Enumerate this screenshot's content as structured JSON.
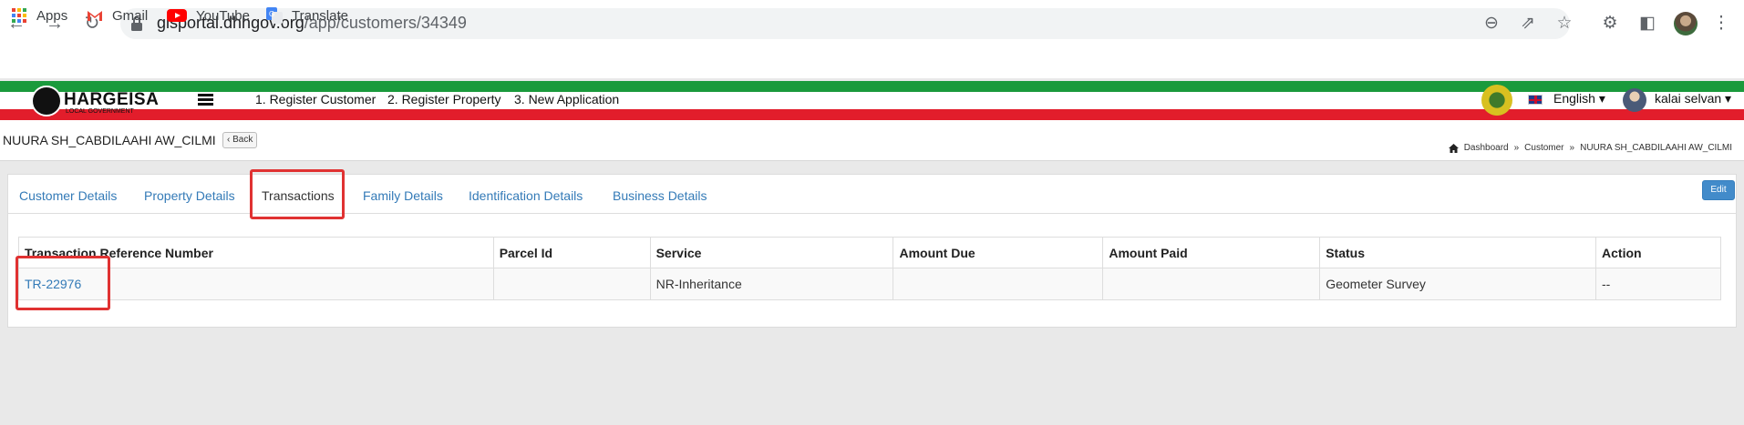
{
  "browser": {
    "url_domain": "gisportal.dhhgov.org",
    "url_path": "/app/customers/34349",
    "bookmarks": [
      {
        "label": "Apps"
      },
      {
        "label": "Gmail"
      },
      {
        "label": "YouTube"
      },
      {
        "label": "Translate"
      }
    ]
  },
  "app": {
    "logo_title": "HARGEISA",
    "logo_subtitle": "LOCAL GOVERNMENT",
    "menu": [
      {
        "label": "1. Register Customer"
      },
      {
        "label": "2. Register Property"
      },
      {
        "label": "3. New Application"
      }
    ],
    "language": "English",
    "user_name": "kalai selvan"
  },
  "page": {
    "customer_name": "NUURA SH_CABDILAAHI AW_CILMI",
    "back_label": "Back",
    "breadcrumb": [
      {
        "label": "Dashboard"
      },
      {
        "label": "Customer"
      },
      {
        "label": "NUURA SH_CABDILAAHI AW_CILMI"
      }
    ],
    "breadcrumb_sep": "»"
  },
  "tabs": [
    {
      "label": "Customer Details",
      "active": false
    },
    {
      "label": "Property Details",
      "active": false
    },
    {
      "label": "Transactions",
      "active": true
    },
    {
      "label": "Family Details",
      "active": false
    },
    {
      "label": "Identification Details",
      "active": false
    },
    {
      "label": "Business Details",
      "active": false
    }
  ],
  "edit_label": "Edit",
  "table": {
    "columns": [
      "Transaction Reference Number",
      "Parcel Id",
      "Service",
      "Amount Due",
      "Amount Paid",
      "Status",
      "Action"
    ],
    "rows": [
      [
        "TR-22976",
        "",
        "NR-Inheritance",
        "",
        "",
        "Geometer Survey",
        "--"
      ]
    ]
  },
  "colors": {
    "link": "#337ab7",
    "highlight": "#e03232",
    "header_green": "#1a9a3c",
    "header_red": "#e21d2b",
    "edit_button": "#428bca"
  }
}
